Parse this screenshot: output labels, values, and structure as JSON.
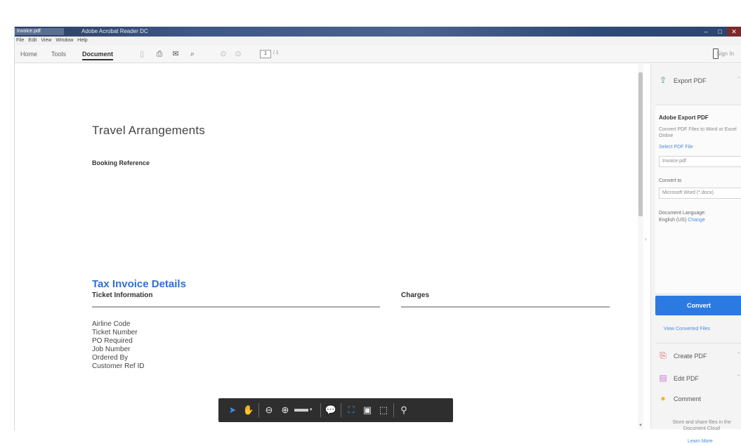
{
  "window": {
    "title": "Adobe Acrobat Reader DC",
    "app_badge": "Invoice.pdf",
    "controls": [
      "–",
      "□",
      "✕"
    ]
  },
  "menu": [
    "File",
    "Edit",
    "View",
    "Window",
    "Help"
  ],
  "nav": {
    "tabs": [
      "Home",
      "Tools",
      "Document"
    ],
    "active_tab": "Document",
    "page_current": "1",
    "page_total": "/ 1",
    "sign_in": "Sign In"
  },
  "document": {
    "title": "Travel Arrangements",
    "booking_reference": "Booking Reference",
    "tax_invoice_title": "Tax Invoice Details",
    "ticket_information": "Ticket Information",
    "charges": "Charges",
    "fields": [
      "Airline Code",
      "Ticket Number",
      "PO Required",
      "Job Number",
      "Ordered By",
      "Customer Ref ID"
    ]
  },
  "right_pane": {
    "export_pdf": "Export PDF",
    "adobe_export_heading": "Adobe Export PDF",
    "adobe_export_desc": "Convert PDF Files to Word or Excel Online",
    "select_pdf_link": "Select PDF File",
    "file_name": "Invoice.pdf",
    "convert_to_label": "Convert to",
    "convert_to_value": "Microsoft Word (*.docx)",
    "doc_language_line1": "Document Language:",
    "doc_language_line2": "English (US)",
    "doc_language_change": "Change",
    "convert_button": "Convert",
    "view_converted": "View Converted Files",
    "create_pdf": "Create PDF",
    "edit_pdf": "Edit PDF",
    "comment": "Comment",
    "store_note": "Store and share files in the Document Cloud",
    "learn_more": "Learn More"
  },
  "colors": {
    "accent_blue": "#2a7ae2",
    "heading_blue": "#2f6fd6",
    "toolbar_dark": "#2e2e2e"
  },
  "icons": {
    "export_pdf": "export-pdf-icon",
    "create_pdf": "create-pdf-icon",
    "edit_pdf": "edit-pdf-icon",
    "comment": "comment-icon"
  }
}
